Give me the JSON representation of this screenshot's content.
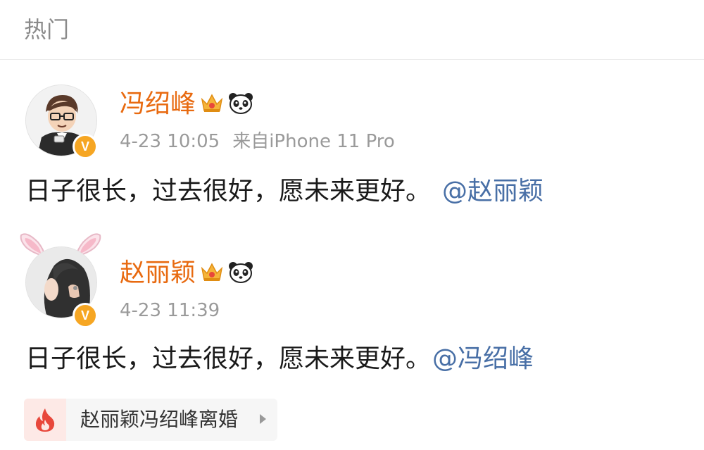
{
  "header": {
    "title": "热门"
  },
  "posts": [
    {
      "username": "冯绍峰",
      "time": "4-23 10:05",
      "source": "来自iPhone 11 Pro",
      "text": "日子很长，过去很好，愿未来更好。",
      "mention": "@赵丽颖",
      "verified": "V"
    },
    {
      "username": "赵丽颖",
      "time": "4-23 11:39",
      "text": "日子很长，过去很好，愿未来更好。",
      "mention": "@冯绍峰",
      "verified": "V"
    }
  ],
  "topic": {
    "label": "赵丽颖冯绍峰离婚"
  },
  "colors": {
    "username": "#e86a10",
    "mention": "#486fa6",
    "meta": "#9a9a9a",
    "verified": "#f6a623",
    "hot_icon": "#e8473b"
  },
  "icons": [
    "crown-icon",
    "panda-icon",
    "verified-icon",
    "fire-icon",
    "chevron-right-icon"
  ]
}
